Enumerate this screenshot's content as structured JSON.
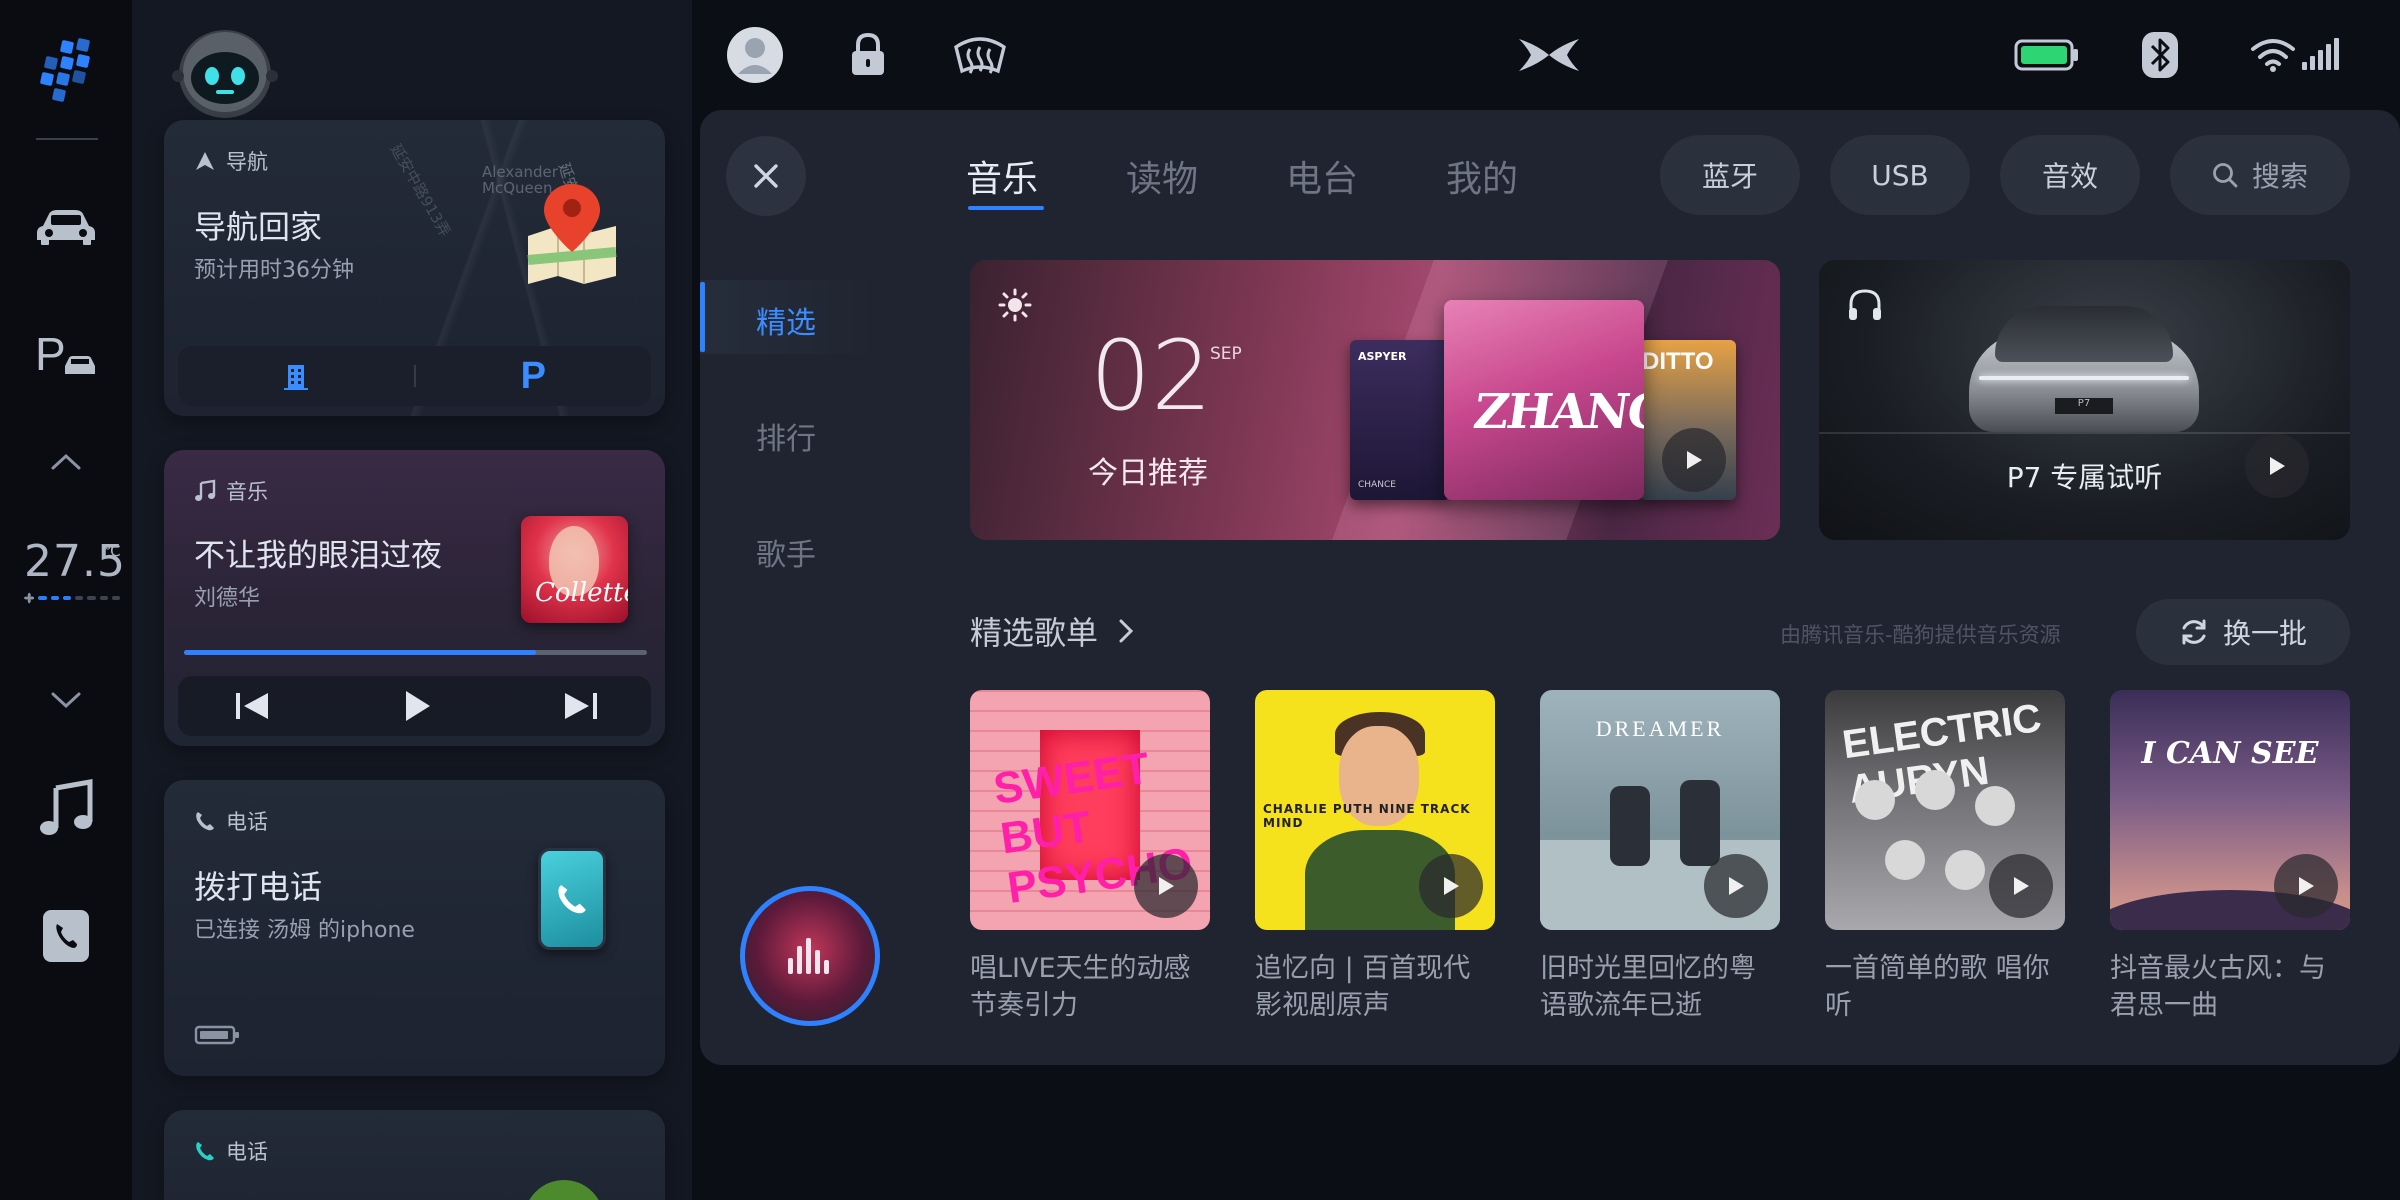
{
  "rail": {
    "icons": [
      "app-grid-icon",
      "car-icon",
      "parking-icon",
      "chevron-up-icon",
      "chevron-down-icon",
      "music-note-icon",
      "phone-icon"
    ],
    "temperature": {
      "value": "27.5",
      "unit": "℃",
      "fan_level": 3,
      "fan_max": 7
    }
  },
  "status_bar": {
    "icons": [
      "user-avatar-icon",
      "lock-icon",
      "defrost-icon",
      "brand-logo-icon",
      "battery-icon",
      "bluetooth-icon",
      "wifi-icon",
      "cellular-signal-icon"
    ],
    "accent": "#2f82ff",
    "battery_color": "#2ed573"
  },
  "cards": {
    "navigation": {
      "header": "导航",
      "title": "导航回家",
      "subtitle": "预计用时36分钟",
      "map_street_1": "延安中路913弄",
      "map_street_2": "延安中路913弄",
      "map_poi": "Alexander McQueen",
      "actions": [
        "building-icon",
        "parking-icon"
      ]
    },
    "music": {
      "header": "音乐",
      "song": "不让我的眼泪过夜",
      "artist": "刘德华",
      "progress": 0.76,
      "album_text": "Collette"
    },
    "phone": {
      "header": "电话",
      "title": "拨打电话",
      "subtitle": "已连接 汤姆 的iphone"
    },
    "phone2": {
      "header": "电话"
    }
  },
  "panel": {
    "tabs": [
      {
        "label": "音乐",
        "active": true
      },
      {
        "label": "读物",
        "active": false
      },
      {
        "label": "电台",
        "active": false
      },
      {
        "label": "我的",
        "active": false
      }
    ],
    "pills": [
      "蓝牙",
      "USB",
      "音效"
    ],
    "search_label": "搜索",
    "subnav": [
      {
        "label": "精选",
        "active": true
      },
      {
        "label": "排行",
        "active": false
      },
      {
        "label": "歌手",
        "active": false
      }
    ],
    "banner_daily": {
      "day": "02",
      "month": "SEP",
      "title": "今日推荐",
      "cover_a_text": "ASPYER",
      "cover_a_footer": "CHANCE",
      "cover_b_text": "ZHANG",
      "cover_c_text": "DITTO"
    },
    "banner_p7": {
      "title": "P7 专属试听",
      "plate": "P7"
    },
    "section": {
      "title": "精选歌单",
      "source_note": "由腾讯音乐-酷狗提供音乐资源",
      "refresh_label": "换一批"
    },
    "playlists": [
      {
        "caption": "唱LIVE天生的动感节奏引力",
        "art_text": "SWEET BUT PSYCHO"
      },
      {
        "caption": "追忆向 | 百首现代影视剧原声",
        "art_text": "CHARLIE PUTH NINE TRACK MIND"
      },
      {
        "caption": "旧时光里回忆的粤语歌流年已逝",
        "art_text": "DREAMER"
      },
      {
        "caption": "一首简单的歌 唱你听",
        "art_text": "ELECTRIC AURYN"
      },
      {
        "caption": "抖音最火古风：与君思一曲",
        "art_text": "I CAN SEE"
      }
    ]
  }
}
